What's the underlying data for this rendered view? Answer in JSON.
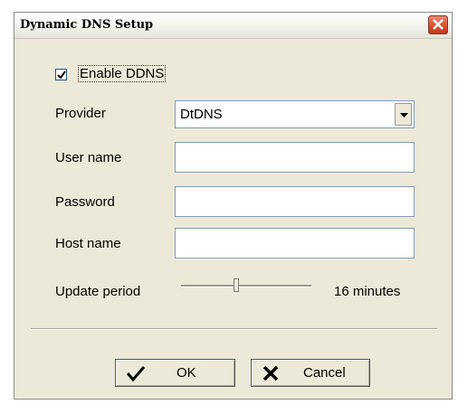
{
  "window": {
    "title": "Dynamic DNS Setup"
  },
  "enable": {
    "label": "Enable DDNS",
    "checked": true
  },
  "provider": {
    "label": "Provider",
    "value": "DtDNS"
  },
  "username": {
    "label": "User name",
    "value": ""
  },
  "password": {
    "label": "Password",
    "value": ""
  },
  "hostname": {
    "label": "Host name",
    "value": ""
  },
  "update": {
    "label": "Update period",
    "value_text": "16 minutes",
    "level_fraction": 0.42
  },
  "buttons": {
    "ok": "OK",
    "cancel": "Cancel"
  },
  "colors": {
    "close_red": "#d9502f",
    "window_bg": "#ece9d8"
  }
}
